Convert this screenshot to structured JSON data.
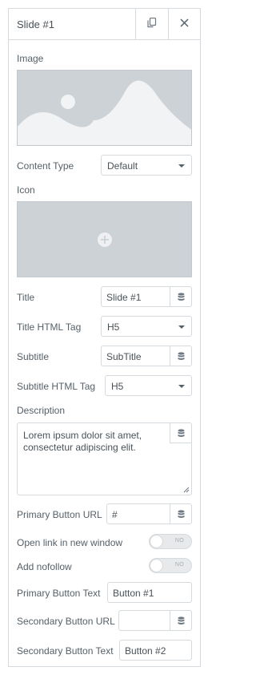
{
  "header": {
    "title": "Slide #1",
    "copy_icon": "copy-icon",
    "close_icon": "close-icon"
  },
  "image": {
    "label": "Image"
  },
  "content_type": {
    "label": "Content Type",
    "value": "Default"
  },
  "icon": {
    "label": "Icon"
  },
  "title": {
    "label": "Title",
    "value": "Slide #1"
  },
  "title_tag": {
    "label": "Title HTML Tag",
    "value": "H5"
  },
  "subtitle": {
    "label": "Subtitle",
    "value": "SubTitle"
  },
  "subtitle_tag": {
    "label": "Subtitle HTML Tag",
    "value": "H5"
  },
  "description": {
    "label": "Description",
    "value": "Lorem ipsum dolor sit amet, consectetur adipiscing elit."
  },
  "primary_url": {
    "label": "Primary Button URL",
    "value": "#"
  },
  "new_window": {
    "label": "Open link in new window",
    "state": "NO"
  },
  "nofollow": {
    "label": "Add nofollow",
    "state": "NO"
  },
  "primary_text": {
    "label": "Primary Button Text",
    "value": "Button #1"
  },
  "secondary_url": {
    "label": "Secondary Button URL",
    "value": ""
  },
  "secondary_text": {
    "label": "Secondary Button Text",
    "value": "Button #2"
  },
  "colors": {
    "placeholder_bg": "#cdd2d7",
    "placeholder_fg": "#f1f3f5",
    "border": "#d5dadf",
    "text": "#556068"
  }
}
